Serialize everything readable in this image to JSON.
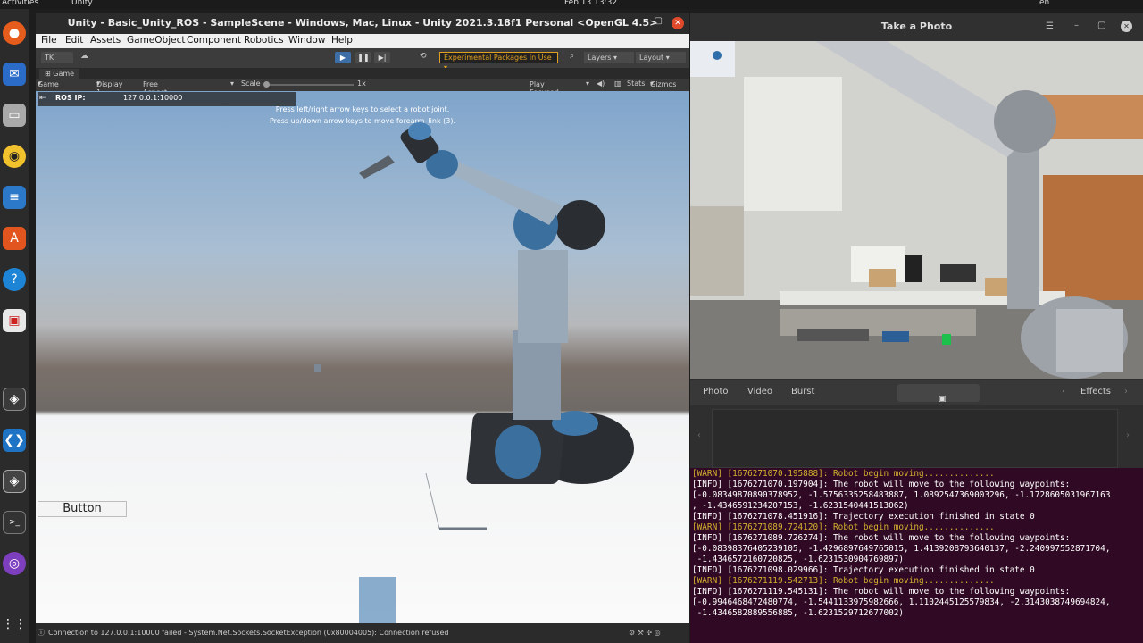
{
  "topbar": {
    "activities": "Activities",
    "app": "Unity",
    "clock": "Feb 13  13:32",
    "lang": "en"
  },
  "unity": {
    "title": "Unity - Basic_Unity_ROS - SampleScene - Windows, Mac, Linux - Unity 2021.3.18f1 Personal <OpenGL 4.5>",
    "menu": [
      "File",
      "Edit",
      "Assets",
      "GameObject",
      "Component",
      "Robotics",
      "Window",
      "Help"
    ],
    "toolbar": {
      "account": "TK",
      "packages": "Experimental Packages In Use",
      "layers": "Layers",
      "layout": "Layout"
    },
    "game_tab": "Game",
    "game_bar": {
      "view": "Game",
      "display": "Display 1",
      "aspect": "Free Aspect",
      "scale_label": "Scale",
      "scale_value": "1x",
      "play_mode": "Play Focused",
      "stats": "Stats",
      "gizmos": "Gizmos"
    },
    "ros_ip_label": "ROS IP:",
    "ros_ip_value": "127.0.0.1:10000",
    "hint1": "Press left/right arrow keys to select a robot joint.",
    "hint2": "Press up/down arrow keys to move forearm_link (3).",
    "button_label": "Button",
    "status": "Connection to 127.0.0.1:10000 failed - System.Net.Sockets.SocketException (0x80004005): Connection refused"
  },
  "photo": {
    "title": "Take a Photo",
    "tabs": [
      "Photo",
      "Video",
      "Burst"
    ],
    "effects": "Effects"
  },
  "terminal": {
    "lines": [
      {
        "level": "warn",
        "text": "[WARN] [1676271070.195888]: Robot begin moving.............."
      },
      {
        "level": "info",
        "text": "[INFO] [1676271070.197904]: The robot will move to the following waypoints:"
      },
      {
        "level": "info",
        "text": "[-0.08349870890378952, -1.5756335258483887, 1.0892547369003296, -1.1728605031967163"
      },
      {
        "level": "info",
        "text": ", -1.4346591234207153, -1.6231540441513062)"
      },
      {
        "level": "info",
        "text": "[INFO] [1676271078.451916]: Trajectory execution finished in state 0"
      },
      {
        "level": "warn",
        "text": "[WARN] [1676271089.724120]: Robot begin moving.............."
      },
      {
        "level": "info",
        "text": "[INFO] [1676271089.726274]: The robot will move to the following waypoints:"
      },
      {
        "level": "info",
        "text": "[-0.08398376405239105, -1.4296897649765015, 1.4139208793640137, -2.240997552871704,"
      },
      {
        "level": "info",
        "text": " -1.4346572160720825, -1.6231530904769897)"
      },
      {
        "level": "info",
        "text": "[INFO] [1676271098.029966]: Trajectory execution finished in state 0"
      },
      {
        "level": "warn",
        "text": "[WARN] [1676271119.542713]: Robot begin moving.............."
      },
      {
        "level": "info",
        "text": "[INFO] [1676271119.545131]: The robot will move to the following waypoints:"
      },
      {
        "level": "info",
        "text": "[-0.9946468472480774, -1.5441133975982666, 1.1102445125579834, -2.3143038749694824,"
      },
      {
        "level": "info",
        "text": " -1.4346582889556885, -1.6231529712677002)"
      }
    ]
  }
}
